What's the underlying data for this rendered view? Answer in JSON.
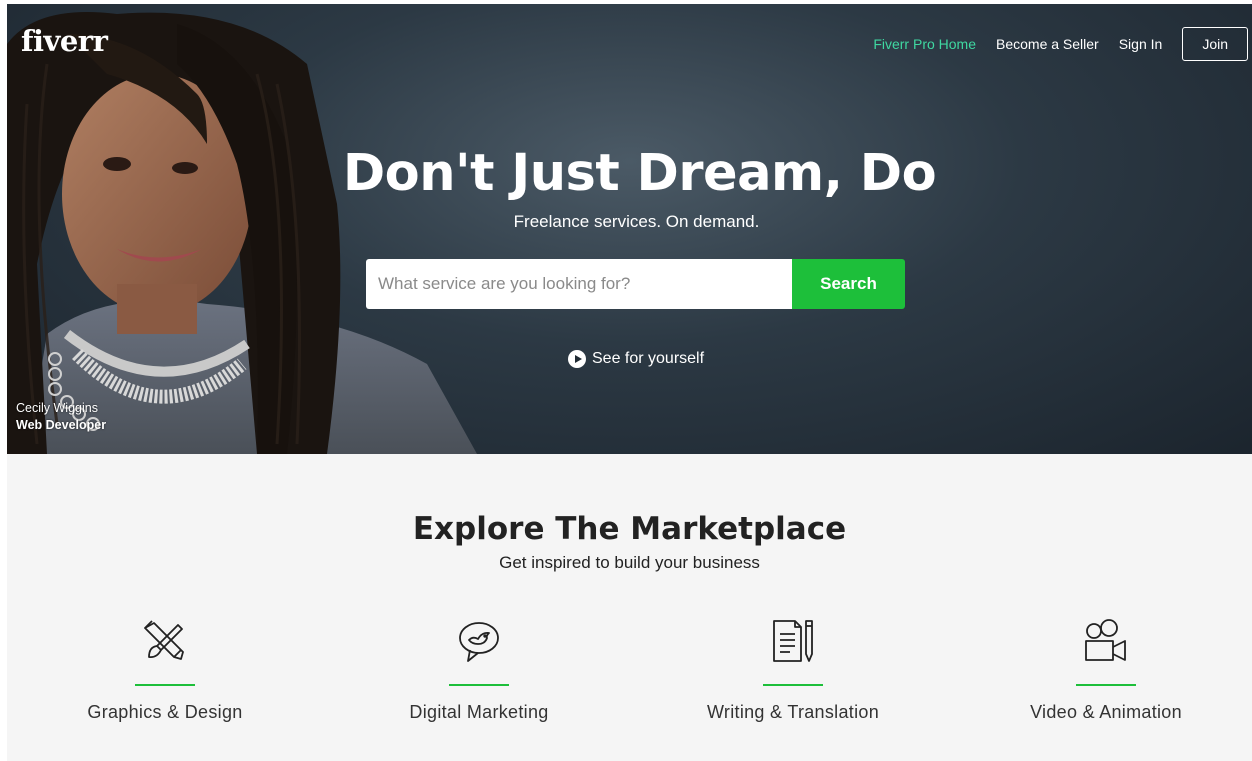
{
  "brand": {
    "logo": "fiverr"
  },
  "nav": {
    "pro": "Fiverr Pro Home",
    "seller": "Become a Seller",
    "signin": "Sign In",
    "join": "Join"
  },
  "hero": {
    "headline": "Don't Just Dream, Do",
    "subline": "Freelance services. On demand.",
    "search_placeholder": "What service are you looking for?",
    "search_button": "Search",
    "video_link": "See for yourself",
    "credit_name": "Cecily Wiggins",
    "credit_role": "Web Developer"
  },
  "explore": {
    "title": "Explore The Marketplace",
    "subtitle": "Get inspired to build your business",
    "categories": [
      {
        "label": "Graphics & Design",
        "icon": "pencil-brush-icon"
      },
      {
        "label": "Digital Marketing",
        "icon": "speech-bird-icon"
      },
      {
        "label": "Writing & Translation",
        "icon": "document-pen-icon"
      },
      {
        "label": "Video & Animation",
        "icon": "video-camera-icon"
      }
    ]
  },
  "colors": {
    "accent": "#1dbf3a",
    "pro_link": "#3fd8a1",
    "hero_bg": "#2c3944",
    "section_bg": "#f5f5f5"
  }
}
